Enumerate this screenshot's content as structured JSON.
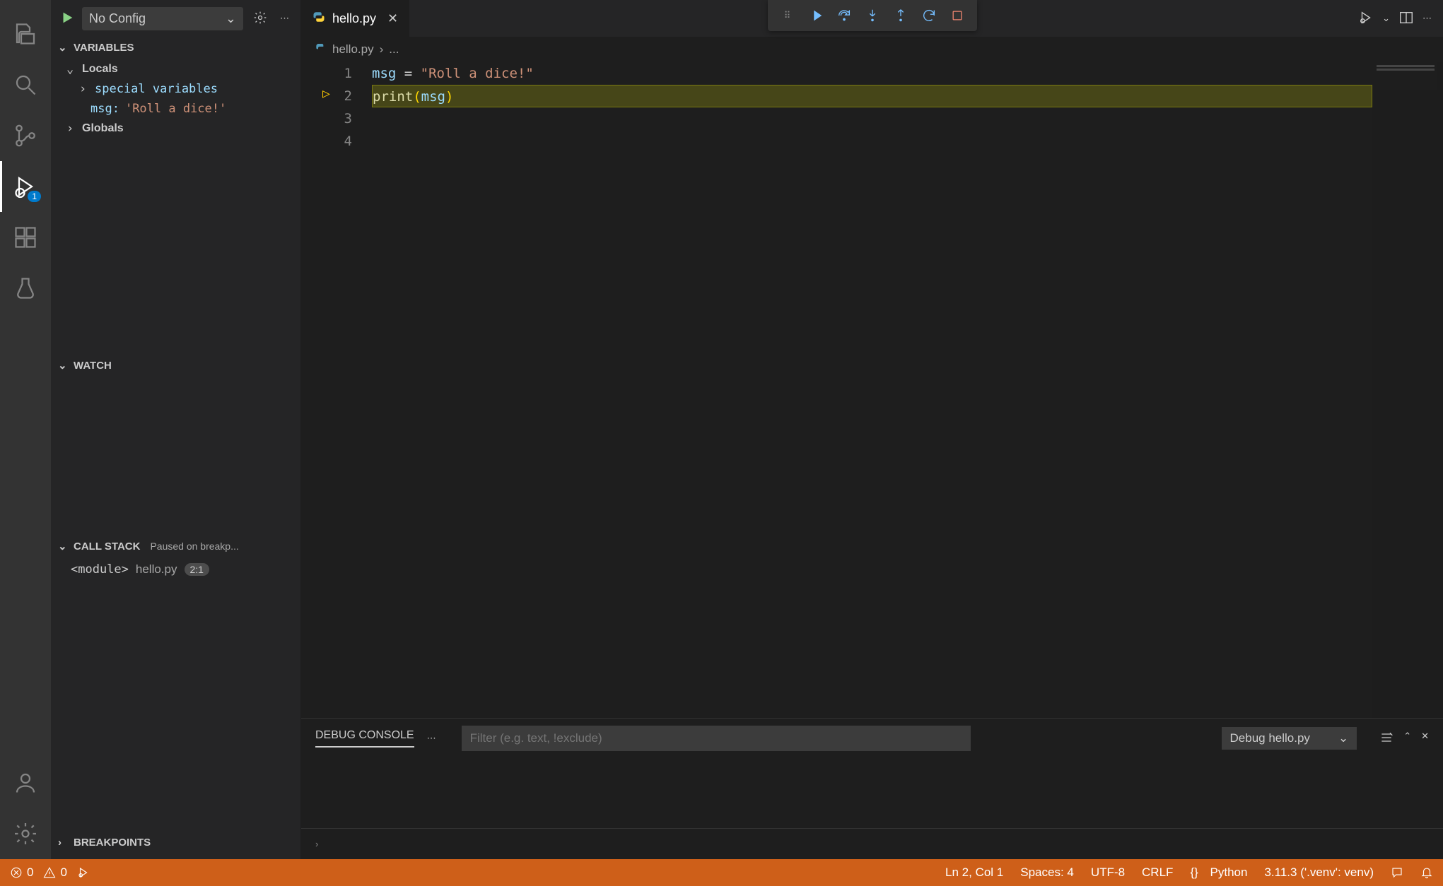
{
  "debugHeader": {
    "configLabel": "No Config"
  },
  "panels": {
    "variables": {
      "title": "VARIABLES",
      "scopes": {
        "locals": "Locals",
        "special": "special variables",
        "msgName": "msg:",
        "msgValue": "'Roll a dice!'",
        "globals": "Globals"
      }
    },
    "watch": {
      "title": "WATCH"
    },
    "callstack": {
      "title": "CALL STACK",
      "status": "Paused on breakp...",
      "frameModule": "<module>",
      "frameFile": "hello.py",
      "framePos": "2:1"
    },
    "breakpoints": {
      "title": "BREAKPOINTS"
    }
  },
  "tabs": {
    "file": "hello.py"
  },
  "breadcrumb": {
    "file": "hello.py",
    "more": "..."
  },
  "code": {
    "lines": [
      "1",
      "2",
      "3",
      "4"
    ],
    "l1_var": "msg",
    "l1_eq": " = ",
    "l1_str": "\"Roll a dice!\"",
    "l2_fn": "print",
    "l2_lp": "(",
    "l2_arg": "msg",
    "l2_rp": ")"
  },
  "debugConsole": {
    "tab": "DEBUG CONSOLE",
    "filterPlaceholder": "Filter (e.g. text, !exclude)",
    "sessionSelect": "Debug hello.py"
  },
  "statusBar": {
    "errors": "0",
    "warnings": "0",
    "cursor": "Ln 2, Col 1",
    "spaces": "Spaces: 4",
    "encoding": "UTF-8",
    "eol": "CRLF",
    "langIcon": "{}",
    "lang": "Python",
    "interpreter": "3.11.3 ('.venv': venv)"
  },
  "debugBadge": "1"
}
